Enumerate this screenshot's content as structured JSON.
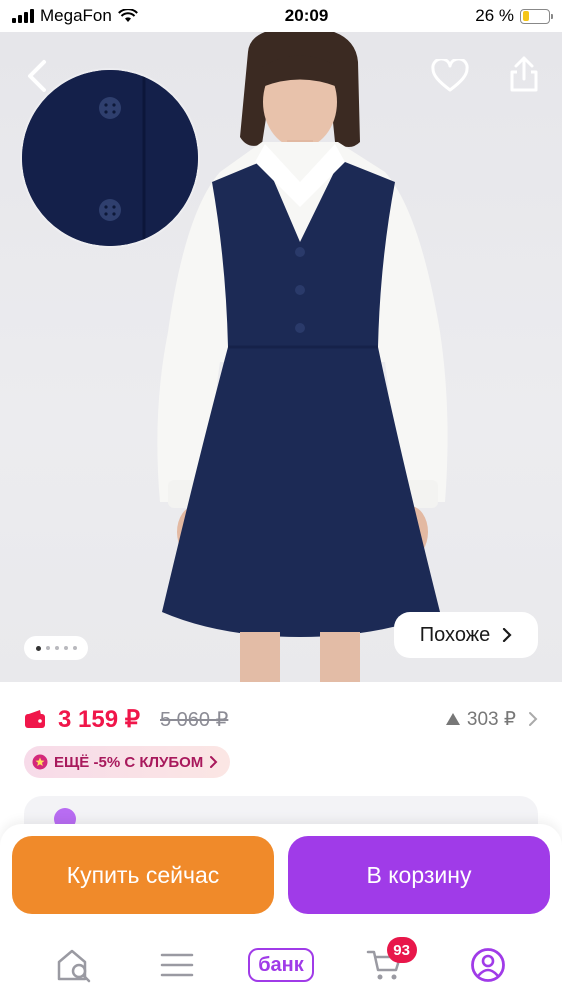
{
  "status_bar": {
    "carrier": "MegaFon",
    "time": "20:09",
    "battery_text": "26 %",
    "battery_level": 0.26
  },
  "hero": {
    "similar_label": "Похоже",
    "gallery_page_count": 5,
    "gallery_active_index": 0
  },
  "price": {
    "current": "3 159 ₽",
    "old": "5 060 ₽",
    "rating_delta": "303 ₽"
  },
  "club_badge": {
    "label": "ЕЩЁ -5% С КЛУБОМ"
  },
  "promo": {
    "text": "... ... ..."
  },
  "actions": {
    "buy_now": "Купить сейчас",
    "add_to_cart": "В корзину"
  },
  "tab_bar": {
    "bank_label": "банк",
    "cart_count": "93"
  },
  "colors": {
    "accent_purple": "#a03be8",
    "buy_orange": "#f08a2a",
    "price_red": "#f0164a",
    "dress_navy": "#1c2a55"
  },
  "icons": [
    "back-icon",
    "heart-icon",
    "share-icon",
    "wallet-icon",
    "triangle-up-icon",
    "chevron-right-icon",
    "home-search-icon",
    "menu-icon",
    "cart-icon",
    "profile-icon"
  ]
}
